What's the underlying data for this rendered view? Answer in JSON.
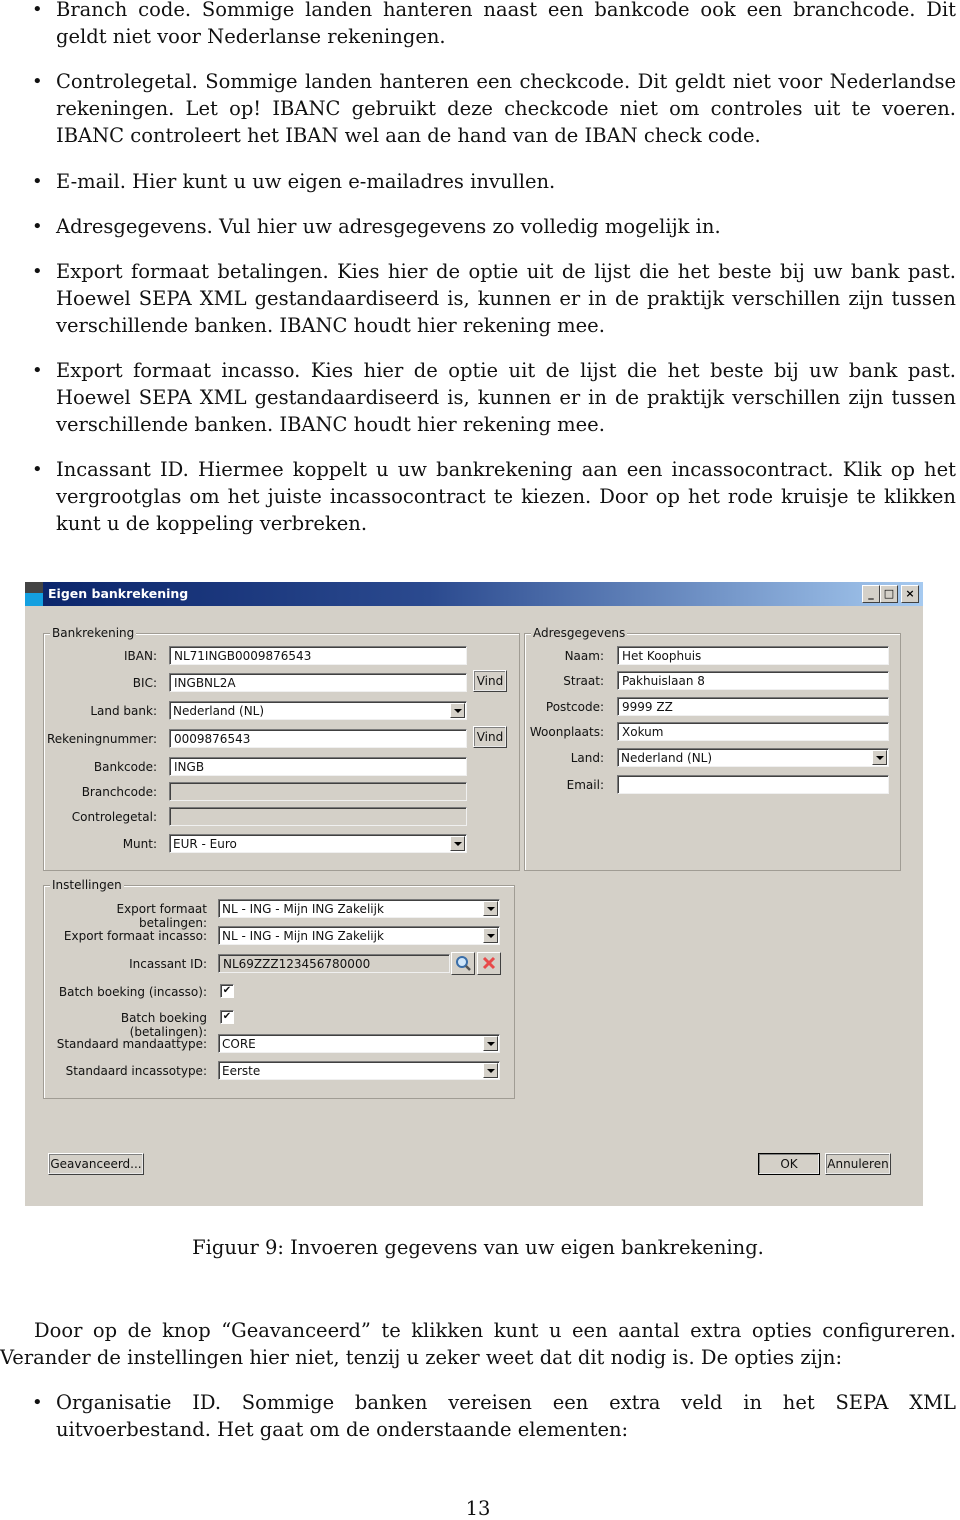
{
  "bullets_top": [
    {
      "text": "Branch code. Sommige landen hanteren naast een bankcode ook een branchcode. Dit geldt niet voor Nederlanse rekeningen."
    },
    {
      "text": "Controlegetal. Sommige landen hanteren een checkcode. Dit geldt niet voor Nederlandse rekeningen. Let op! IBANC gebruikt deze checkcode niet om controles uit te voeren. IBANC controleert het IBAN wel aan de hand van de IBAN check code."
    },
    {
      "text": "E-mail. Hier kunt u uw eigen e-mailadres invullen."
    },
    {
      "text": "Adresgegevens. Vul hier uw adresgegevens zo volledig mogelijk in."
    },
    {
      "text": "Export formaat betalingen. Kies hier de optie uit de lijst die het beste bij uw bank past. Hoewel SEPA XML gestandaardiseerd is, kunnen er in de praktijk verschillen zijn tussen verschillende banken. IBANC houdt hier rekening mee."
    },
    {
      "text": "Export formaat incasso. Kies hier de optie uit de lijst die het beste bij uw bank past. Hoewel SEPA XML gestandaardiseerd is, kunnen er in de praktijk verschillen zijn tussen verschillende banken. IBANC houdt hier rekening mee."
    },
    {
      "text": "Incassant ID. Hiermee koppelt u uw bankrekening aan een incassocontract. Klik op het vergrootglas om het juiste incassocontract te kiezen. Door op het rode kruisje te klikken kunt u de koppeling verbreken."
    }
  ],
  "window": {
    "title": "Eigen bankrekening",
    "controls": {
      "minimize": "_",
      "maximize": "□",
      "close": "×"
    },
    "bankrekening": {
      "group_label": "Bankrekening",
      "iban_label": "IBAN:",
      "iban_value": "NL71INGB0009876543",
      "bic_label": "BIC:",
      "bic_value": "INGBNL2A",
      "bic_button": "Vind",
      "landbank_label": "Land bank:",
      "landbank_value": "Nederland (NL)",
      "rekeningnummer_label": "Rekeningnummer:",
      "rekeningnummer_value": "0009876543",
      "rekeningnummer_button": "Vind",
      "bankcode_label": "Bankcode:",
      "bankcode_value": "INGB",
      "branchcode_label": "Branchcode:",
      "branchcode_value": "",
      "controlegetal_label": "Controlegetal:",
      "controlegetal_value": "",
      "munt_label": "Munt:",
      "munt_value": "EUR - Euro"
    },
    "adresgegevens": {
      "group_label": "Adresgegevens",
      "naam_label": "Naam:",
      "naam_value": "Het Koophuis",
      "straat_label": "Straat:",
      "straat_value": "Pakhuislaan 8",
      "postcode_label": "Postcode:",
      "postcode_value": "9999 ZZ",
      "woonplaats_label": "Woonplaats:",
      "woonplaats_value": "Xokum",
      "land_label": "Land:",
      "land_value": "Nederland (NL)",
      "email_label": "Email:",
      "email_value": ""
    },
    "instellingen": {
      "group_label": "Instellingen",
      "export_betalingen_label": "Export formaat betalingen:",
      "export_betalingen_value": "NL - ING - Mijn ING Zakelijk",
      "export_incasso_label": "Export formaat incasso:",
      "export_incasso_value": "NL - ING - Mijn ING Zakelijk",
      "incassant_label": "Incassant ID:",
      "incassant_value": "NL69ZZZ123456780000",
      "batch_incasso_label": "Batch boeking (incasso):",
      "batch_incasso_checked": true,
      "batch_betalingen_label": "Batch boeking (betalingen):",
      "batch_betalingen_checked": true,
      "mandaattype_label": "Standaard mandaattype:",
      "mandaattype_value": "CORE",
      "incassotype_label": "Standaard incassotype:",
      "incassotype_value": "Eerste"
    },
    "buttons": {
      "advanced": "Geavanceerd...",
      "ok": "OK",
      "cancel": "Annuleren"
    }
  },
  "caption": "Figuur 9: Invoeren gegevens van uw eigen bankrekening.",
  "paragraph": "Door op de knop “Geavanceerd” te klikken kunt u een aantal extra opties configureren. Verander de instellingen hier niet, tenzij u zeker weet dat dit nodig is. De opties zijn:",
  "bullets_bottom": [
    {
      "text": "Organisatie ID. Sommige banken vereisen een extra veld in het SEPA XML uitvoerbestand. Het gaat om de onderstaande elementen:"
    }
  ],
  "page_number": "13"
}
